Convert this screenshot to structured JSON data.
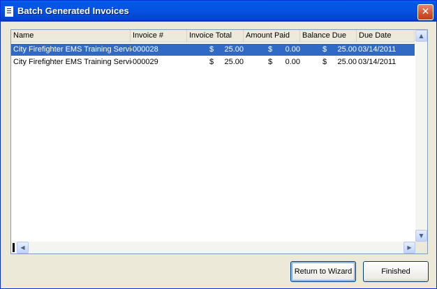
{
  "window": {
    "title": "Batch Generated Invoices",
    "close_glyph": "✕"
  },
  "columns": [
    "Name",
    "Invoice #",
    "Invoice Total",
    "Amount Paid",
    "Balance Due",
    "Due Date"
  ],
  "rows": [
    {
      "name": "City Firefighter EMS Training Service",
      "invoice": "000028",
      "total_cur": "$",
      "total": "25.00",
      "paid_cur": "$",
      "paid": "0.00",
      "balance_cur": "$",
      "balance": "25.00",
      "due": "03/14/2011",
      "selected": true
    },
    {
      "name": "City Firefighter EMS Training Service",
      "invoice": "000029",
      "total_cur": "$",
      "total": "25.00",
      "paid_cur": "$",
      "paid": "0.00",
      "balance_cur": "$",
      "balance": "25.00",
      "due": "03/14/2011",
      "selected": false
    }
  ],
  "scroll": {
    "up": "▲",
    "down": "▼",
    "left": "◀",
    "right": "▶"
  },
  "buttons": {
    "return": "Return to Wizard",
    "finished": "Finished"
  }
}
